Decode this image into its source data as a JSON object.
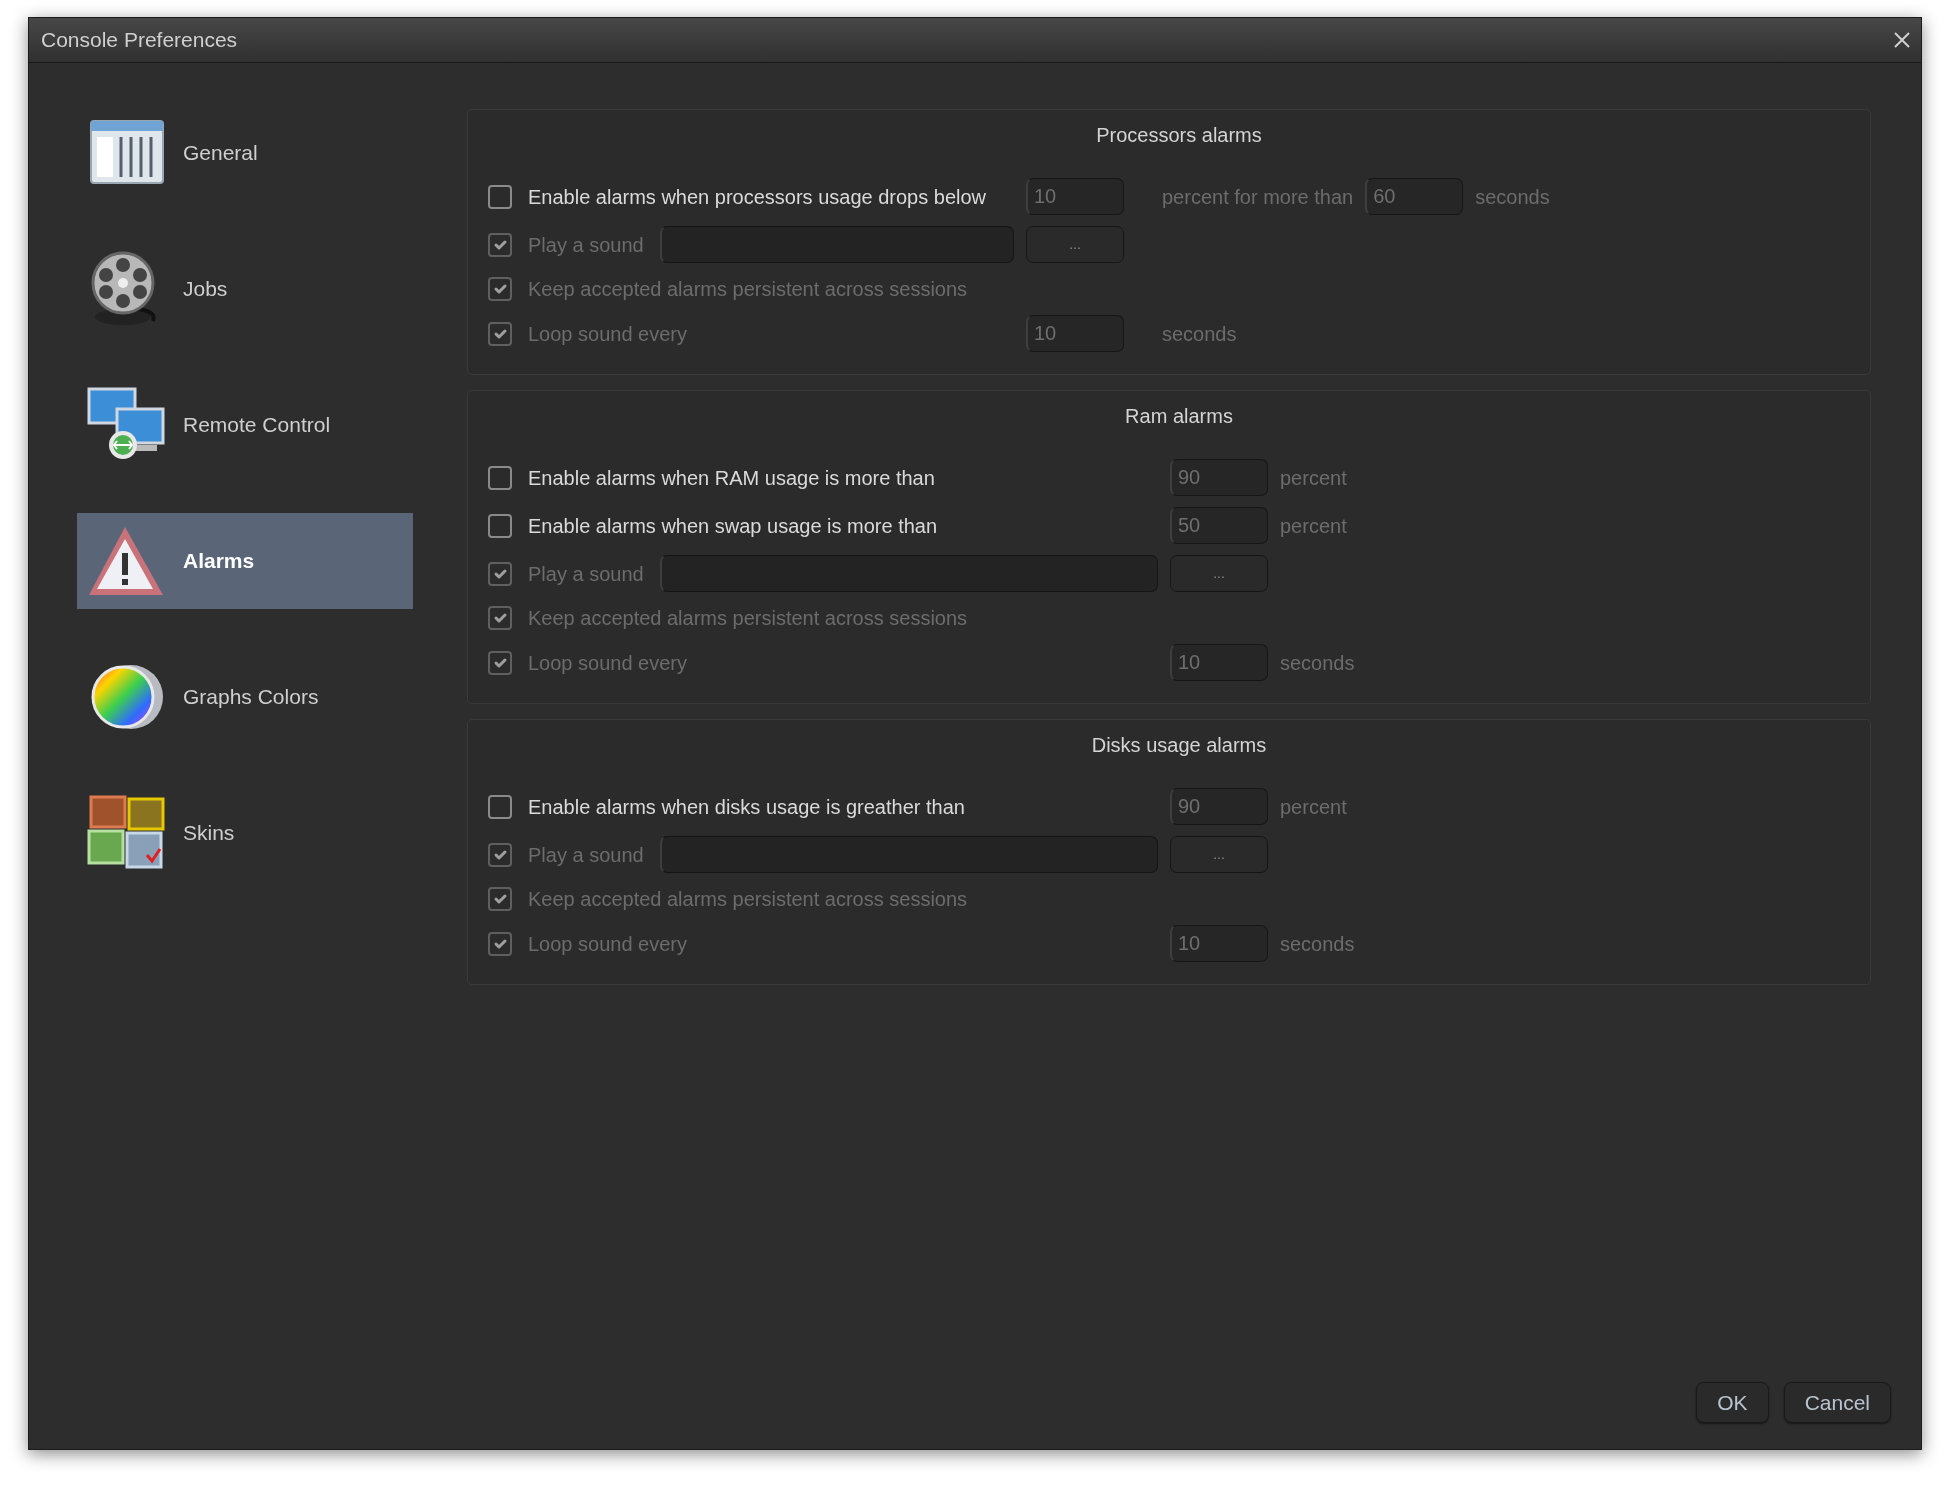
{
  "window": {
    "title": "Console Preferences"
  },
  "sidebar": {
    "items": [
      {
        "label": "General",
        "kind": "window",
        "selected": false
      },
      {
        "label": "Jobs",
        "kind": "reel",
        "selected": false
      },
      {
        "label": "Remote Control",
        "kind": "monitors",
        "selected": false
      },
      {
        "label": "Alarms",
        "kind": "warning",
        "selected": true
      },
      {
        "label": "Graphs Colors",
        "kind": "wheel",
        "selected": false
      },
      {
        "label": "Skins",
        "kind": "pictures",
        "selected": false
      }
    ]
  },
  "groups": [
    {
      "title": "Processors alarms",
      "rows": [
        {
          "kind": "check",
          "checked": false,
          "disabled": false,
          "label": "Enable alarms when processors usage drops below",
          "fields": [
            {
              "value": "10",
              "suffix": "percent for more than"
            },
            {
              "value": "60",
              "suffix": "seconds"
            }
          ]
        },
        {
          "kind": "sound",
          "checked": true,
          "disabled": true,
          "label": "Play a sound",
          "button": "..."
        },
        {
          "kind": "check",
          "checked": true,
          "disabled": true,
          "label": "Keep accepted alarms persistent across sessions"
        },
        {
          "kind": "check",
          "checked": true,
          "disabled": true,
          "label": "Loop sound every",
          "fields": [
            {
              "value": "10",
              "suffix": "seconds"
            }
          ]
        }
      ]
    },
    {
      "title": "Ram alarms",
      "rows": [
        {
          "kind": "check",
          "checked": false,
          "disabled": false,
          "label": "Enable alarms when RAM usage is more than",
          "fields": [
            {
              "value": "90",
              "suffix": "percent"
            }
          ]
        },
        {
          "kind": "check",
          "checked": false,
          "disabled": false,
          "label": "Enable alarms when swap usage is more than",
          "fields": [
            {
              "value": "50",
              "suffix": "percent"
            }
          ]
        },
        {
          "kind": "sound",
          "checked": true,
          "disabled": true,
          "label": "Play a sound",
          "button": "..."
        },
        {
          "kind": "check",
          "checked": true,
          "disabled": true,
          "label": "Keep accepted alarms persistent across sessions"
        },
        {
          "kind": "check",
          "checked": true,
          "disabled": true,
          "label": "Loop sound every",
          "fields": [
            {
              "value": "10",
              "suffix": "seconds"
            }
          ]
        }
      ]
    },
    {
      "title": "Disks usage alarms",
      "rows": [
        {
          "kind": "check",
          "checked": false,
          "disabled": false,
          "label": "Enable alarms when disks usage is greather than",
          "fields": [
            {
              "value": "90",
              "suffix": "percent"
            }
          ]
        },
        {
          "kind": "sound",
          "checked": true,
          "disabled": true,
          "label": "Play a sound",
          "button": "..."
        },
        {
          "kind": "check",
          "checked": true,
          "disabled": true,
          "label": "Keep accepted alarms persistent across sessions"
        },
        {
          "kind": "check",
          "checked": true,
          "disabled": true,
          "label": "Loop sound every",
          "fields": [
            {
              "value": "10",
              "suffix": "seconds"
            }
          ]
        }
      ]
    }
  ],
  "buttons": [
    {
      "label": "OK"
    },
    {
      "label": "Cancel"
    }
  ]
}
